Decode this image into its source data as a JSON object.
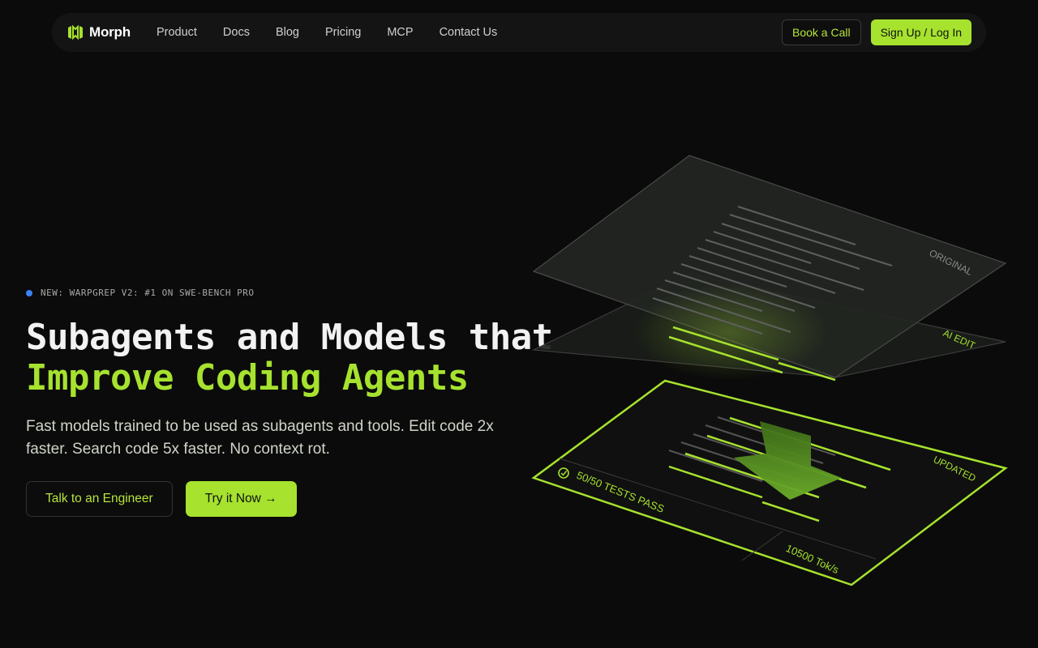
{
  "nav": {
    "brand": "Morph",
    "links": [
      "Product",
      "Docs",
      "Blog",
      "Pricing",
      "MCP",
      "Contact Us"
    ],
    "book_call": "Book a Call",
    "signup": "Sign Up / Log In"
  },
  "hero": {
    "badge": "NEW: WARPGREP V2: #1 ON SWE-BENCH PRO",
    "headline_line1": "Subagents and Models that",
    "headline_line2": "Improve Coding Agents",
    "subtitle": "Fast models trained to be used as subagents and tools. Edit code 2x faster. Search code 5x faster. No context rot.",
    "cta_secondary": "Talk to an Engineer",
    "cta_primary": "Try it Now →"
  },
  "illustration": {
    "layer_original": "ORIGINAL",
    "layer_ai_edit": "AI EDIT",
    "layer_updated": "UPDATED",
    "tests": "50/50 TESTS PASS",
    "speed": "10500 Tok/s"
  },
  "colors": {
    "accent": "#a6e22e",
    "background": "#0b0b0b",
    "badge_dot": "#3b82f6"
  }
}
